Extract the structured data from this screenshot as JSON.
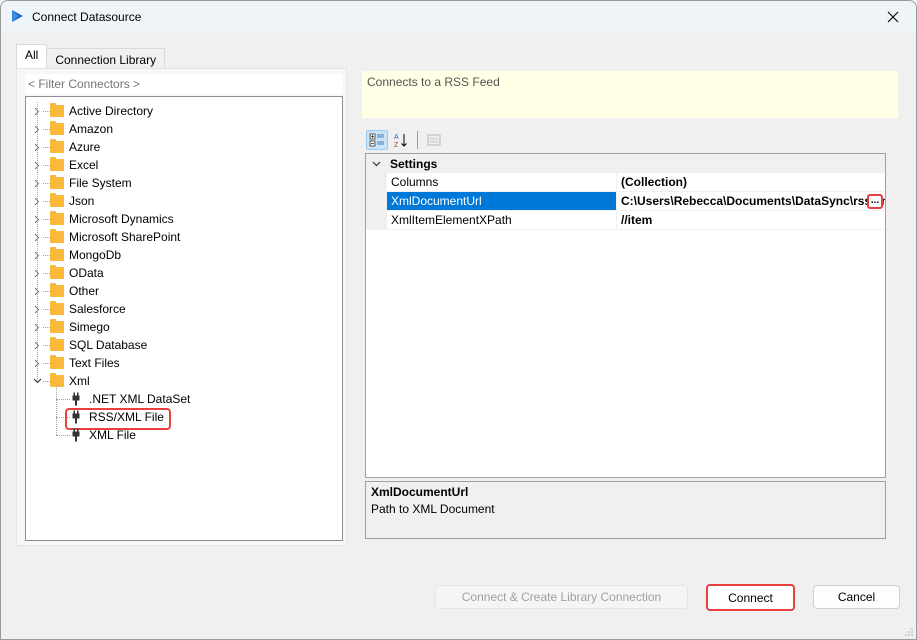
{
  "window": {
    "title": "Connect Datasource",
    "accent_color": "#0078d7",
    "highlight_color": "#e8403f"
  },
  "left": {
    "tabs": [
      {
        "label": "All",
        "active": true
      },
      {
        "label": "Connection Library",
        "active": false
      }
    ],
    "filter_placeholder": "< Filter Connectors >",
    "tree": [
      {
        "label": "Active Directory",
        "expanded": false
      },
      {
        "label": "Amazon",
        "expanded": false
      },
      {
        "label": "Azure",
        "expanded": false
      },
      {
        "label": "Excel",
        "expanded": false
      },
      {
        "label": "File System",
        "expanded": false
      },
      {
        "label": "Json",
        "expanded": false
      },
      {
        "label": "Microsoft Dynamics",
        "expanded": false
      },
      {
        "label": "Microsoft SharePoint",
        "expanded": false
      },
      {
        "label": "MongoDb",
        "expanded": false
      },
      {
        "label": "OData",
        "expanded": false
      },
      {
        "label": "Other",
        "expanded": false
      },
      {
        "label": "Salesforce",
        "expanded": false
      },
      {
        "label": "Simego",
        "expanded": false
      },
      {
        "label": "SQL Database",
        "expanded": false
      },
      {
        "label": "Text Files",
        "expanded": false
      },
      {
        "label": "Xml",
        "expanded": true,
        "children": [
          {
            "label": ".NET XML DataSet"
          },
          {
            "label": "RSS/XML File",
            "highlighted": true
          },
          {
            "label": "XML File"
          }
        ]
      }
    ]
  },
  "right": {
    "description": "Connects to a RSS Feed",
    "toolbar": {
      "categorized": "categorized-view",
      "alphabetical": "alphabetical-sort",
      "property_pages": "property-pages"
    },
    "category": "Settings",
    "properties": [
      {
        "name": "Columns",
        "value": "(Collection)",
        "selected": false
      },
      {
        "name": "XmlDocumentUrl",
        "value": "C:\\Users\\Rebecca\\Documents\\DataSync\\rss.xml",
        "selected": true,
        "ellipsis": "..."
      },
      {
        "name": "XmlItemElementXPath",
        "value": "//item",
        "selected": false
      }
    ],
    "help": {
      "title": "XmlDocumentUrl",
      "description": "Path to XML Document"
    }
  },
  "buttons": {
    "create_library": "Connect & Create Library Connection",
    "connect": "Connect",
    "cancel": "Cancel"
  }
}
